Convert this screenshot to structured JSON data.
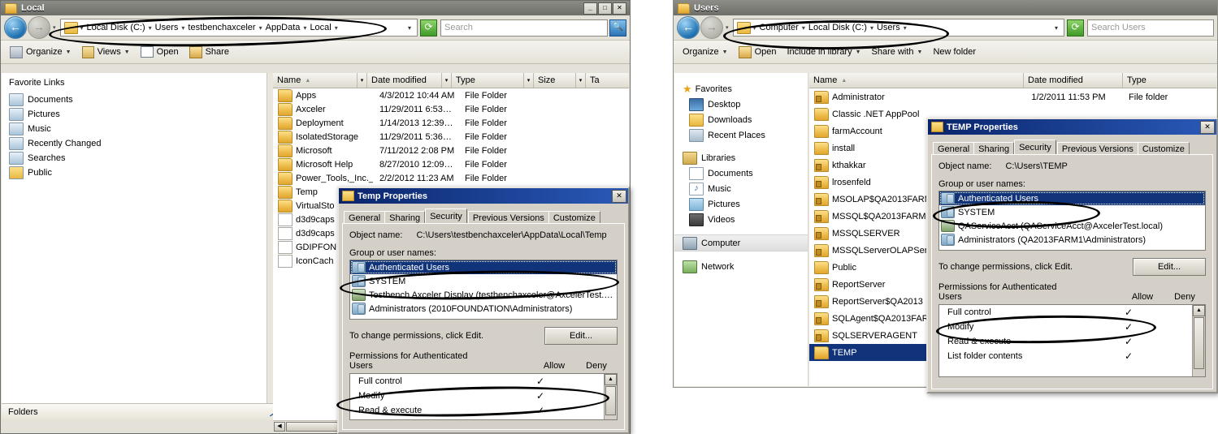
{
  "left_window": {
    "title": "Local",
    "window_buttons": [
      "_",
      "□",
      "✕"
    ],
    "address": {
      "crumbs": [
        "Local Disk (C:)",
        "Users",
        "testbenchaxceler",
        "AppData",
        "Local"
      ],
      "search_placeholder": "Search",
      "refresh_icon": "refresh-icon",
      "back_icon": "back-arrow-icon",
      "forward_icon": "forward-arrow-icon"
    },
    "toolbar": [
      {
        "label": "Organize",
        "icon": "organize-icon",
        "caret": true
      },
      {
        "label": "Views",
        "icon": "views-icon",
        "caret": true
      },
      {
        "label": "Open",
        "icon": "open-icon",
        "caret": false
      },
      {
        "label": "Share",
        "icon": "share-icon",
        "caret": false
      }
    ],
    "favorites_header": "Favorite Links",
    "favorites": [
      {
        "label": "Documents",
        "icon": "documents-icon"
      },
      {
        "label": "Pictures",
        "icon": "pictures-icon"
      },
      {
        "label": "Music",
        "icon": "music-icon"
      },
      {
        "label": "Recently Changed",
        "icon": "recently-changed-icon"
      },
      {
        "label": "Searches",
        "icon": "searches-icon"
      },
      {
        "label": "Public",
        "icon": "public-folder-icon"
      }
    ],
    "folders_bar": "Folders",
    "columns": [
      "Name",
      "Date modified",
      "Type",
      "Size",
      "Ta"
    ],
    "sort_indicator": "▲",
    "files": [
      {
        "name": "Apps",
        "date": "4/3/2012 10:44 AM",
        "type": "File Folder",
        "icon": "folder-icon"
      },
      {
        "name": "Axceler",
        "date": "11/29/2011 6:53…",
        "type": "File Folder",
        "icon": "folder-icon"
      },
      {
        "name": "Deployment",
        "date": "1/14/2013 12:39…",
        "type": "File Folder",
        "icon": "folder-icon"
      },
      {
        "name": "IsolatedStorage",
        "date": "11/29/2011 5:36…",
        "type": "File Folder",
        "icon": "folder-icon"
      },
      {
        "name": "Microsoft",
        "date": "7/11/2012 2:08 PM",
        "type": "File Folder",
        "icon": "folder-icon"
      },
      {
        "name": "Microsoft Help",
        "date": "8/27/2010 12:09…",
        "type": "File Folder",
        "icon": "folder-icon"
      },
      {
        "name": "Power_Tools,_Inc._…",
        "date": "2/2/2012 11:23 AM",
        "type": "File Folder",
        "icon": "folder-icon"
      },
      {
        "name": "Temp",
        "date": "",
        "type": "",
        "icon": "folder-icon"
      },
      {
        "name": "VirtualSto",
        "date": "",
        "type": "",
        "icon": "folder-icon"
      },
      {
        "name": "d3d9caps",
        "date": "",
        "type": "",
        "icon": "file-icon"
      },
      {
        "name": "d3d9caps",
        "date": "",
        "type": "",
        "icon": "file-icon"
      },
      {
        "name": "GDIPFON",
        "date": "",
        "type": "",
        "icon": "file-icon"
      },
      {
        "name": "IconCach",
        "date": "",
        "type": "",
        "icon": "file-icon"
      }
    ]
  },
  "left_dialog": {
    "title": "Temp Properties",
    "close_label": "✕",
    "tabs": [
      "General",
      "Sharing",
      "Security",
      "Previous Versions",
      "Customize"
    ],
    "active_tab": "Security",
    "object_name_label": "Object name:",
    "object_name_value": "C:\\Users\\testbenchaxceler\\AppData\\Local\\Temp",
    "group_label": "Group or user names:",
    "groups": [
      {
        "name": "Authenticated Users",
        "icon": "group-icon",
        "selected": true
      },
      {
        "name": "SYSTEM",
        "icon": "group-icon",
        "selected": false
      },
      {
        "name": "Testbench Axceler Display (testbenchaxceler@AxcelerTest.…",
        "icon": "user-icon",
        "selected": false
      },
      {
        "name": "Administrators (2010FOUNDATION\\Administrators)",
        "icon": "group-icon",
        "selected": false
      }
    ],
    "change_text": "To change permissions, click Edit.",
    "edit_button": "Edit...",
    "perm_label_line1": "Permissions for Authenticated",
    "perm_label_line2": "Users",
    "allow_header": "Allow",
    "deny_header": "Deny",
    "permissions": [
      {
        "name": "Full control",
        "allow": "✓",
        "deny": ""
      },
      {
        "name": "Modify",
        "allow": "✓",
        "deny": ""
      },
      {
        "name": "Read & execute",
        "allow": "✓",
        "deny": ""
      }
    ]
  },
  "right_window": {
    "title": "Users",
    "address": {
      "crumbs": [
        "Computer",
        "Local Disk (C:)",
        "Users"
      ],
      "search_placeholder": "Search Users",
      "refresh_icon": "refresh-icon",
      "back_icon": "back-arrow-icon",
      "forward_icon": "forward-arrow-icon"
    },
    "toolbar": [
      {
        "label": "Organize",
        "icon": "organize-icon",
        "caret": true
      },
      {
        "label": "Open",
        "icon": "open-icon",
        "caret": false
      },
      {
        "label": "Include in library",
        "icon": "library-icon",
        "caret": true
      },
      {
        "label": "Share with",
        "icon": "share-icon",
        "caret": true
      },
      {
        "label": "New folder",
        "icon": "new-folder-icon",
        "caret": false
      }
    ],
    "nav_pane": [
      {
        "label": "Favorites",
        "icon": "star-icon",
        "level": 0
      },
      {
        "label": "Desktop",
        "icon": "desktop-icon",
        "level": 1
      },
      {
        "label": "Downloads",
        "icon": "downloads-icon",
        "level": 1
      },
      {
        "label": "Recent Places",
        "icon": "recent-places-icon",
        "level": 1
      },
      {
        "label": "Libraries",
        "icon": "libraries-icon",
        "level": 0
      },
      {
        "label": "Documents",
        "icon": "documents-icon",
        "level": 1
      },
      {
        "label": "Music",
        "icon": "music-icon",
        "level": 1
      },
      {
        "label": "Pictures",
        "icon": "pictures-icon",
        "level": 1
      },
      {
        "label": "Videos",
        "icon": "videos-icon",
        "level": 1
      },
      {
        "label": "Computer",
        "icon": "computer-icon",
        "level": 0,
        "current": true
      },
      {
        "label": "Network",
        "icon": "network-icon",
        "level": 0
      }
    ],
    "columns": [
      "Name",
      "Date modified",
      "Type"
    ],
    "sort_indicator": "▲",
    "files": [
      {
        "name": "Administrator",
        "date": "1/2/2011 11:53 PM",
        "type": "File folder",
        "icon": "user-folder-icon",
        "selected": false
      },
      {
        "name": "Classic .NET AppPool",
        "date": "",
        "type": "",
        "icon": "folder-icon",
        "selected": false
      },
      {
        "name": "farmAccount",
        "date": "",
        "type": "",
        "icon": "folder-icon",
        "selected": false
      },
      {
        "name": "install",
        "date": "",
        "type": "",
        "icon": "folder-icon",
        "selected": false
      },
      {
        "name": "kthakkar",
        "date": "",
        "type": "",
        "icon": "user-folder-icon",
        "selected": false
      },
      {
        "name": "lrosenfeld",
        "date": "",
        "type": "",
        "icon": "user-folder-icon",
        "selected": false
      },
      {
        "name": "MSOLAP$QA2013FARM",
        "date": "",
        "type": "",
        "icon": "user-folder-icon",
        "selected": false
      },
      {
        "name": "MSSQL$QA2013FARM1",
        "date": "",
        "type": "",
        "icon": "user-folder-icon",
        "selected": false
      },
      {
        "name": "MSSQLSERVER",
        "date": "",
        "type": "",
        "icon": "user-folder-icon",
        "selected": false
      },
      {
        "name": "MSSQLServerOLAPServ",
        "date": "",
        "type": "",
        "icon": "user-folder-icon",
        "selected": false
      },
      {
        "name": "Public",
        "date": "",
        "type": "",
        "icon": "folder-icon",
        "selected": false
      },
      {
        "name": "ReportServer",
        "date": "",
        "type": "",
        "icon": "user-folder-icon",
        "selected": false
      },
      {
        "name": "ReportServer$QA2013",
        "date": "",
        "type": "",
        "icon": "user-folder-icon",
        "selected": false
      },
      {
        "name": "SQLAgent$QA2013FAR",
        "date": "",
        "type": "",
        "icon": "user-folder-icon",
        "selected": false
      },
      {
        "name": "SQLSERVERAGENT",
        "date": "",
        "type": "",
        "icon": "user-folder-icon",
        "selected": false
      },
      {
        "name": "TEMP",
        "date": "",
        "type": "",
        "icon": "folder-icon",
        "selected": true
      }
    ]
  },
  "right_dialog": {
    "title": "TEMP Properties",
    "close_label": "✕",
    "tabs": [
      "General",
      "Sharing",
      "Security",
      "Previous Versions",
      "Customize"
    ],
    "active_tab": "Security",
    "object_name_label": "Object name:",
    "object_name_value": "C:\\Users\\TEMP",
    "group_label": "Group or user names:",
    "groups": [
      {
        "name": "Authenticated Users",
        "icon": "group-icon",
        "selected": true
      },
      {
        "name": "SYSTEM",
        "icon": "group-icon",
        "selected": false
      },
      {
        "name": "QAServiceAcct (QAServiceAcct@AxcelerTest.local)",
        "icon": "user-icon",
        "selected": false
      },
      {
        "name": "Administrators (QA2013FARM1\\Administrators)",
        "icon": "group-icon",
        "selected": false
      }
    ],
    "change_text": "To change permissions, click Edit.",
    "edit_button": "Edit...",
    "perm_label_line1": "Permissions for Authenticated",
    "perm_label_line2": "Users",
    "allow_header": "Allow",
    "deny_header": "Deny",
    "permissions": [
      {
        "name": "Full control",
        "allow": "✓",
        "deny": ""
      },
      {
        "name": "Modify",
        "allow": "✓",
        "deny": ""
      },
      {
        "name": "Read & execute",
        "allow": "✓",
        "deny": ""
      },
      {
        "name": "List folder contents",
        "allow": "✓",
        "deny": ""
      }
    ]
  },
  "annotations": {
    "ellipses": [
      {
        "name": "left-address-highlight"
      },
      {
        "name": "left-authenticated-users-highlight"
      },
      {
        "name": "left-full-control-highlight"
      },
      {
        "name": "right-address-highlight"
      },
      {
        "name": "right-authenticated-users-highlight"
      },
      {
        "name": "right-full-control-highlight"
      }
    ]
  },
  "colors": {
    "selection_blue": "#10337a",
    "dialog_title_blue": "#0a246a",
    "dialog_face": "#d4d0c8",
    "explorer_chrome": "#e3e1d8"
  }
}
